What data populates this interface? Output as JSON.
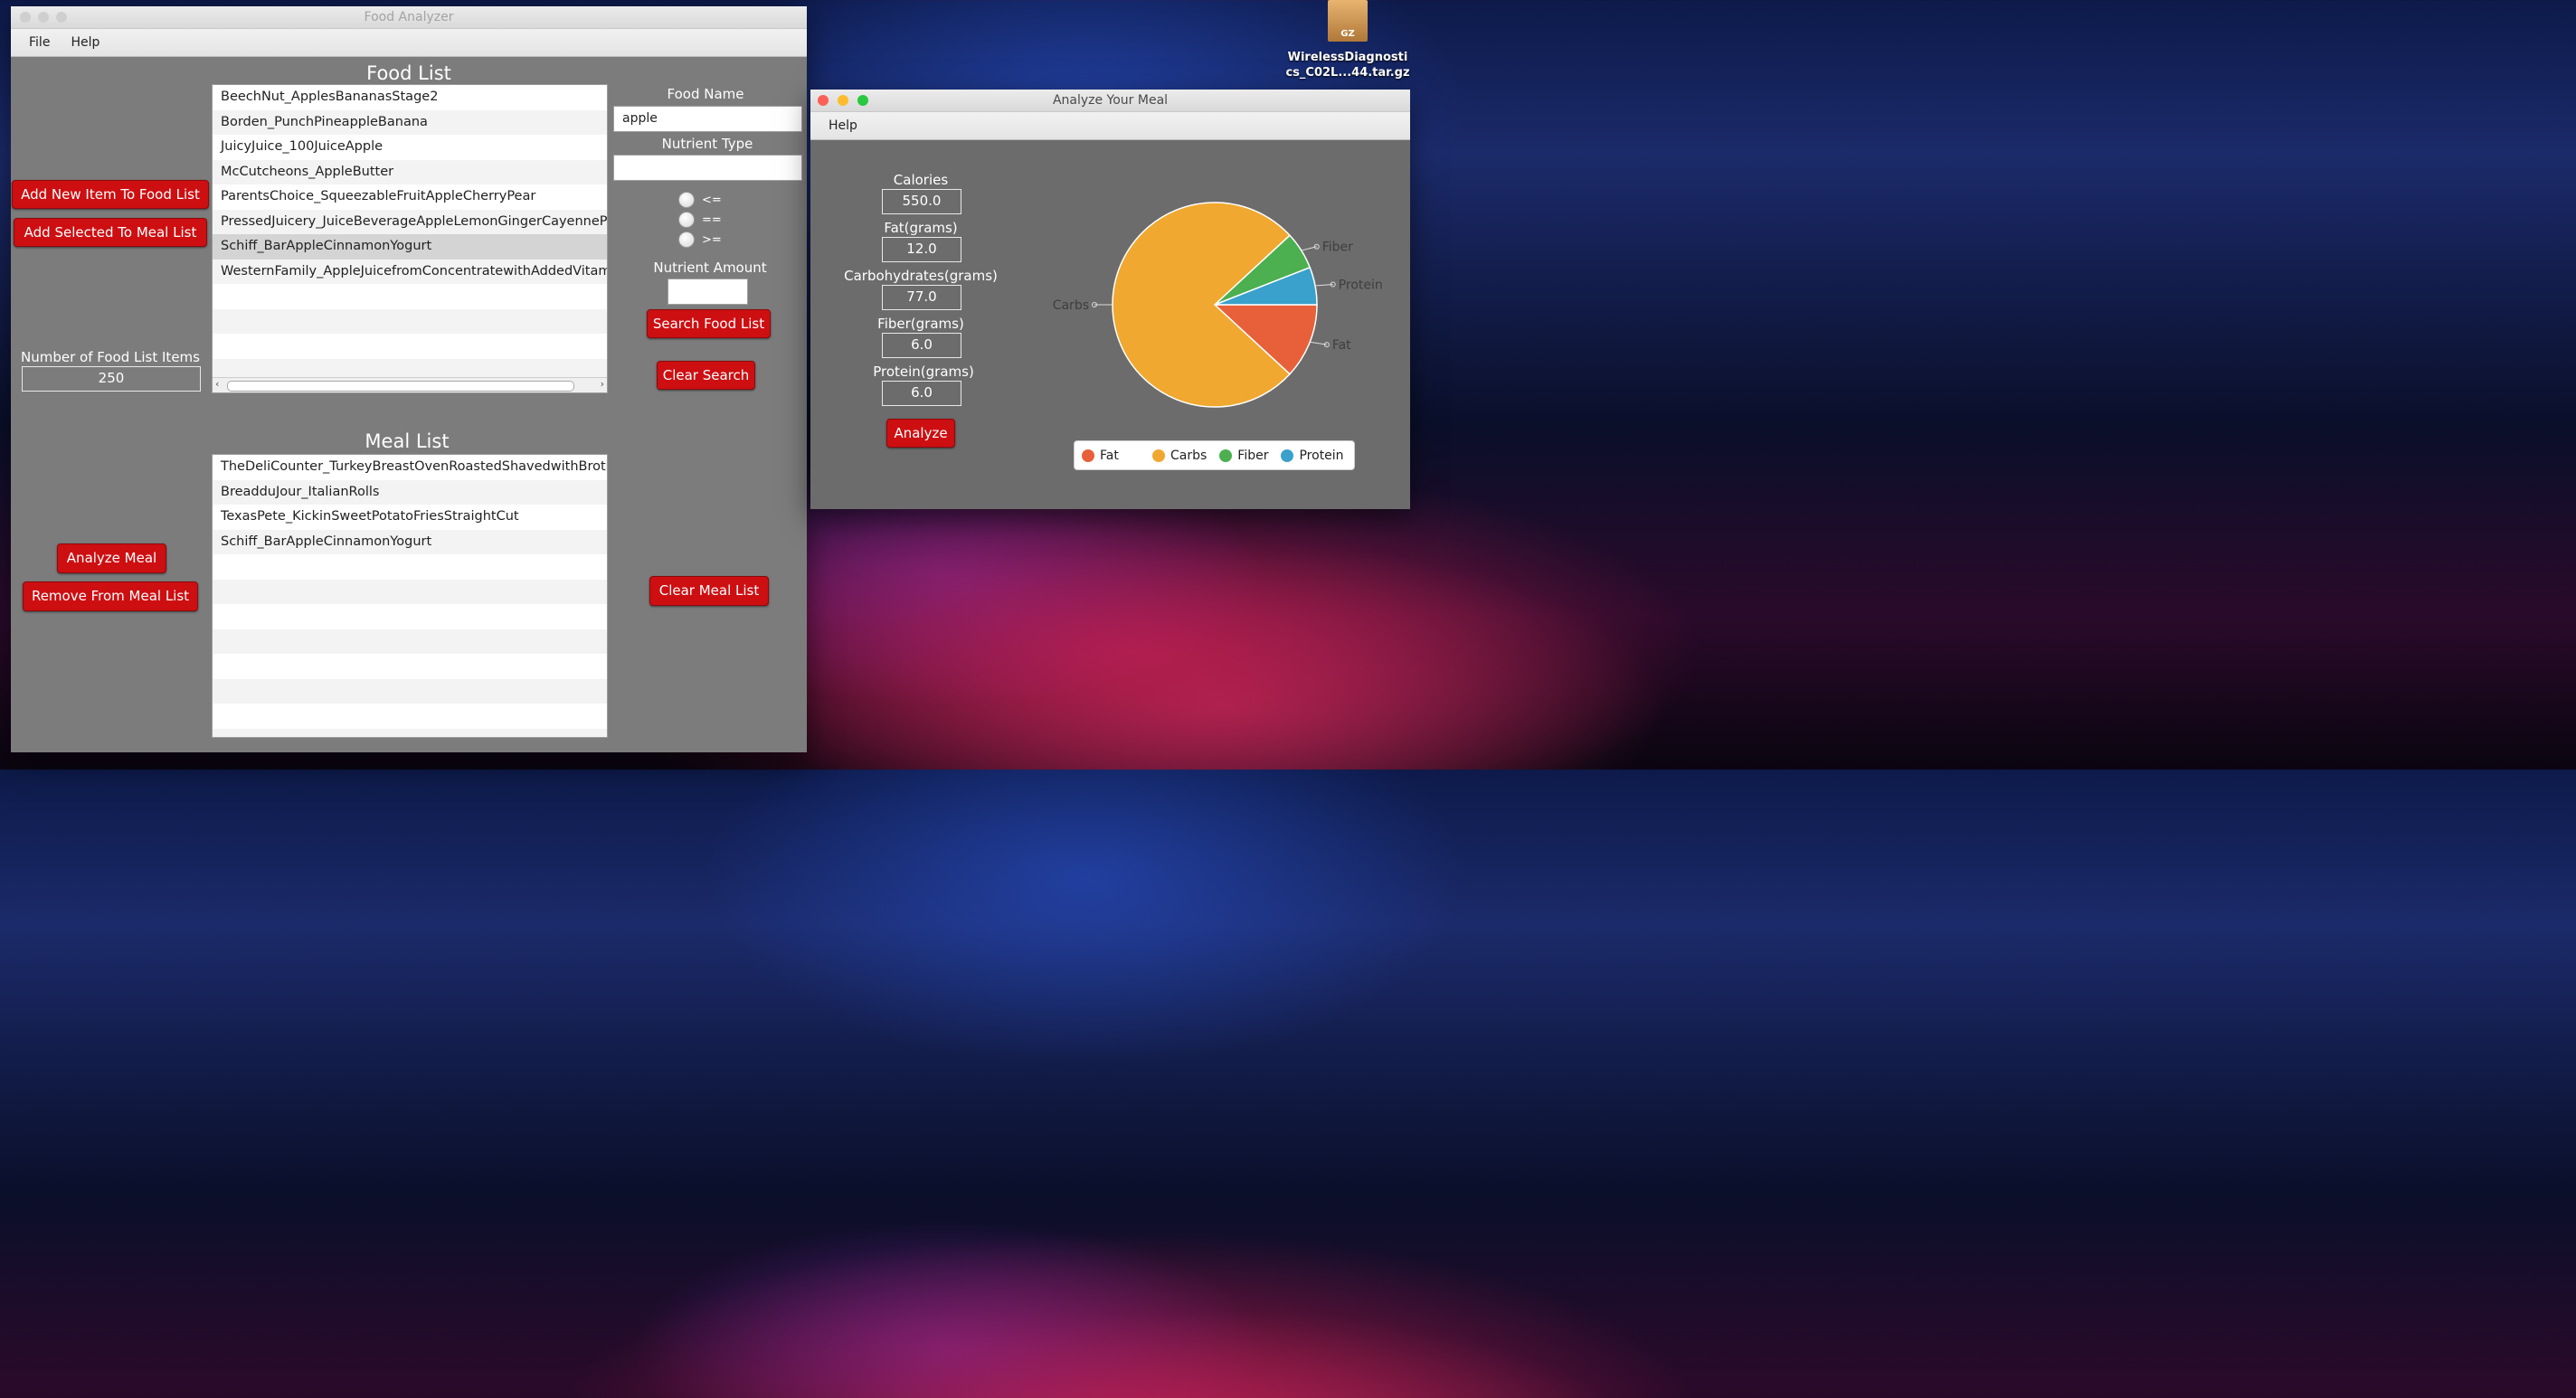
{
  "desktop": {
    "file_label": "WirelessDiagnostics_C02L...44.tar.gz",
    "file_label_line1": "WirelessDiagnosti",
    "file_label_line2": "cs_C02L...44.tar.gz",
    "file_badge": "GZ"
  },
  "main_window": {
    "title": "Food Analyzer",
    "menu": [
      "File",
      "Help"
    ],
    "food_list_title": "Food List",
    "food_items": [
      "BeechNut_ApplesBananasStage2",
      "Borden_PunchPineappleBanana",
      "JuicyJuice_100JuiceApple",
      "McCutcheons_AppleButter",
      "ParentsChoice_SqueezableFruitAppleCherryPear",
      "PressedJuicery_JuiceBeverageAppleLemonGingerCayennePepp",
      "Schiff_BarAppleCinnamonYogurt",
      "WesternFamily_AppleJuicefromConcentratewithAddedVitaminC"
    ],
    "selected_food_index": 6,
    "add_new_item_label": "Add New Item To Food List",
    "add_selected_label": "Add Selected To Meal List",
    "count_label": "Number of Food List Items",
    "count_value": "250",
    "food_name_label": "Food Name",
    "food_name_value": "apple",
    "nutrient_type_label": "Nutrient Type",
    "nutrient_type_value": "",
    "comparators": [
      "<=",
      "==",
      ">="
    ],
    "nutrient_amount_label": "Nutrient Amount",
    "nutrient_amount_value": "",
    "search_label": "Search Food List",
    "clear_search_label": "Clear Search",
    "meal_list_title": "Meal List",
    "meal_items": [
      "TheDeliCounter_TurkeyBreastOvenRoastedShavedwithBroth",
      "BreadduJour_ItalianRolls",
      "TexasPete_KickinSweetPotatoFriesStraightCut",
      "Schiff_BarAppleCinnamonYogurt"
    ],
    "analyze_meal_label": "Analyze Meal",
    "remove_label": "Remove From Meal List",
    "clear_meal_label": "Clear Meal List"
  },
  "analyze_window": {
    "title": "Analyze Your Meal",
    "menu": [
      "Help"
    ],
    "calories_label": "Calories",
    "calories_value": "550.0",
    "fat_label": "Fat(grams)",
    "fat_value": "12.0",
    "carbs_label": "Carbohydrates(grams)",
    "carbs_value": "77.0",
    "fiber_label": "Fiber(grams)",
    "fiber_value": "6.0",
    "protein_label": "Protein(grams)",
    "protein_value": "6.0",
    "analyze_label": "Analyze"
  },
  "chart_data": {
    "type": "pie",
    "title": "",
    "slices": [
      {
        "name": "Fat",
        "value": 12.0,
        "color": "#e8603a"
      },
      {
        "name": "Carbs",
        "value": 77.0,
        "color": "#f0a830"
      },
      {
        "name": "Fiber",
        "value": 6.0,
        "color": "#4caf50"
      },
      {
        "name": "Protein",
        "value": 6.0,
        "color": "#3aa0cc"
      }
    ],
    "legend_placement": "bottom"
  }
}
